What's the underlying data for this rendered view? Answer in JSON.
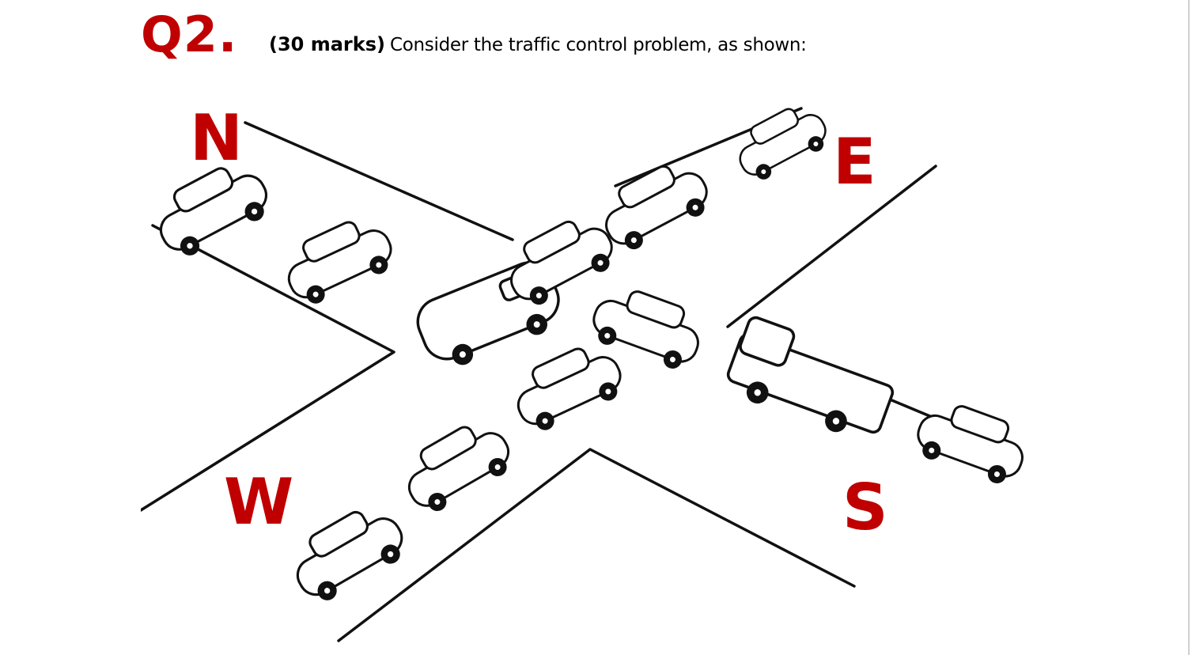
{
  "question": {
    "number": "Q2.",
    "marks": "(30 marks)",
    "prompt": "Consider the traffic control problem, as shown:"
  },
  "figure": {
    "directions": {
      "north": "N",
      "east": "E",
      "west": "W",
      "south": "S"
    }
  },
  "colors": {
    "accent": "#c00000",
    "text": "#000000",
    "background": "#ffffff"
  }
}
